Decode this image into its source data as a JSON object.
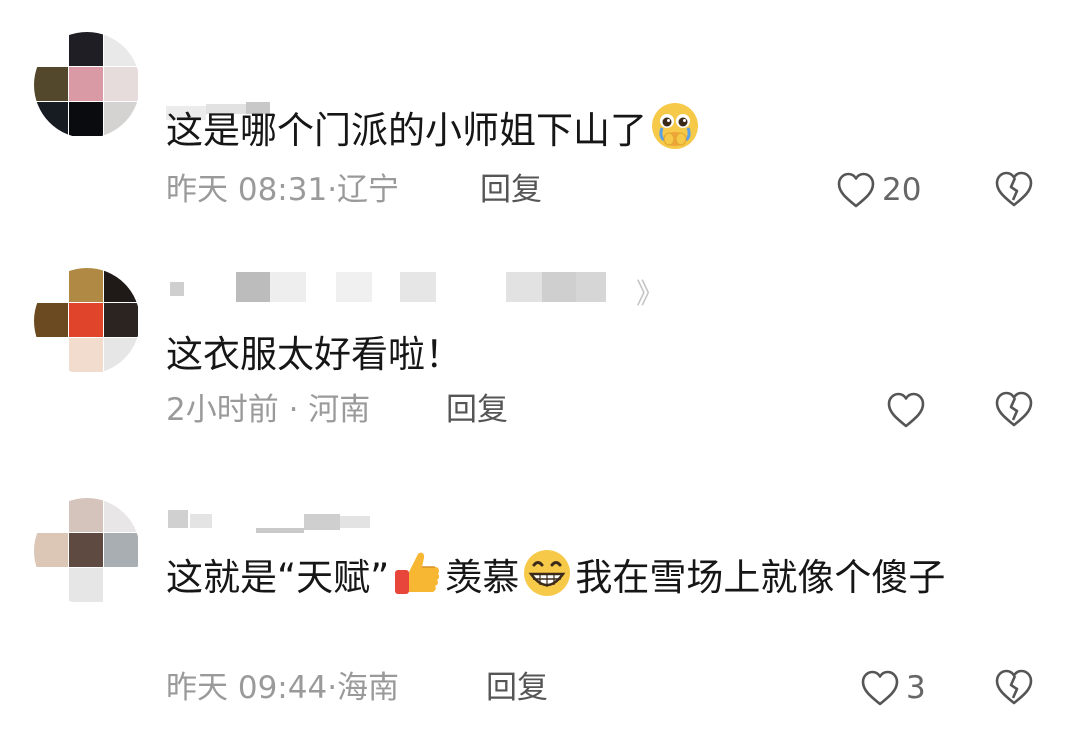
{
  "comments": [
    {
      "text": "这是哪个门派的小师姐下山了",
      "emoji": "pleading-crying-face-emoji",
      "time": "昨天 08:31·",
      "region": "辽宁",
      "reply": "回复",
      "likes": "20",
      "avatar_colors": [
        "#ffffff",
        "#1e1e24",
        "#e9e9e9",
        "#54482c",
        "#d99aa5",
        "#e7dcdc",
        "#171c22",
        "#090b0e",
        "#d5d3d1"
      ],
      "username_blur": [
        "#ececec",
        "#d7d7d7",
        "#bdbdbd"
      ]
    },
    {
      "text": "这衣服太好看啦！",
      "time": "2小时前 ·",
      "region": "河南",
      "reply": "回复",
      "likes": "",
      "avatar_colors": [
        "#ffffff",
        "#b08a44",
        "#1f1a17",
        "#6b4a22",
        "#e0442a",
        "#2c2421",
        "#ffffff",
        "#f1dccd",
        "#e6e6e6"
      ],
      "username_blur": [
        "#e2e2e2",
        "#bbbbbb",
        "#f2f2f2",
        "#dddddd",
        "#e8e8e8",
        "#cfcfcf",
        "#dedede"
      ]
    },
    {
      "text": "这就是“天赋”",
      "text2": "羡慕",
      "text3": "我在雪场上就像个傻子",
      "emoji": "thumbs-up-emoji",
      "emoji2": "grinning-face-emoji",
      "time": "昨天 09:44·",
      "region": "海南",
      "reply": "回复",
      "likes": "3",
      "avatar_colors": [
        "#ffffff",
        "#d5c4bc",
        "#e8e6e6",
        "#dcc6b6",
        "#5e4a41",
        "#a9aeb3",
        "#ffffff",
        "#e6e6e6",
        "#ffffff"
      ],
      "username_blur": [
        "#cfcfcf",
        "#dcdcdc",
        "#c4c4c4",
        "#e6e6e6"
      ]
    }
  ],
  "chevron": "》",
  "colors": {
    "meta": "#9a9a9a",
    "reply": "#555555",
    "icon": "#555555"
  }
}
